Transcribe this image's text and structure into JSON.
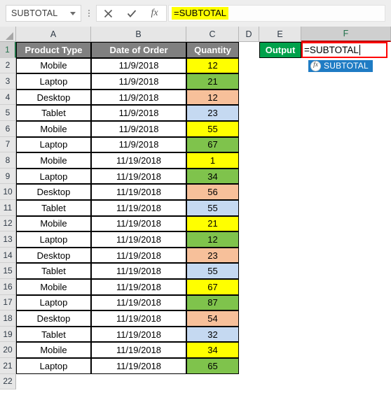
{
  "formula_bar": {
    "name_box_value": "SUBTOTAL",
    "name_box_icon": "chevron-down-icon",
    "cancel_icon": "cancel-x-icon",
    "confirm_icon": "confirm-check-icon",
    "insert_function_icon": "fx-icon",
    "insert_function_label": "fx",
    "formula_value": "=SUBTOTAL"
  },
  "columns": [
    {
      "label": "A",
      "selected": false
    },
    {
      "label": "B",
      "selected": false
    },
    {
      "label": "C",
      "selected": false
    },
    {
      "label": "D",
      "selected": false
    },
    {
      "label": "E",
      "selected": false
    },
    {
      "label": "F",
      "selected": true
    }
  ],
  "row_numbers": [
    "1",
    "2",
    "3",
    "4",
    "5",
    "6",
    "7",
    "8",
    "9",
    "10",
    "11",
    "12",
    "13",
    "14",
    "15",
    "16",
    "17",
    "18",
    "19",
    "20",
    "21",
    "22"
  ],
  "table": {
    "headers": [
      "Product Type",
      "Date of Order",
      "Quantity"
    ],
    "header_bg": "#808080",
    "header_color": "#ffffff",
    "rows": [
      {
        "product": "Mobile",
        "date": "11/9/2018",
        "qty": "12",
        "qty_color": "#ffff00"
      },
      {
        "product": "Laptop",
        "date": "11/9/2018",
        "qty": "21",
        "qty_color": "#7fc34c"
      },
      {
        "product": "Desktop",
        "date": "11/9/2018",
        "qty": "12",
        "qty_color": "#f7c09a"
      },
      {
        "product": "Tablet",
        "date": "11/9/2018",
        "qty": "23",
        "qty_color": "#c5d9f1"
      },
      {
        "product": "Mobile",
        "date": "11/9/2018",
        "qty": "55",
        "qty_color": "#ffff00"
      },
      {
        "product": "Laptop",
        "date": "11/9/2018",
        "qty": "67",
        "qty_color": "#7fc34c"
      },
      {
        "product": "Mobile",
        "date": "11/19/2018",
        "qty": "1",
        "qty_color": "#ffff00"
      },
      {
        "product": "Laptop",
        "date": "11/19/2018",
        "qty": "34",
        "qty_color": "#7fc34c"
      },
      {
        "product": "Desktop",
        "date": "11/19/2018",
        "qty": "56",
        "qty_color": "#f7c09a"
      },
      {
        "product": "Tablet",
        "date": "11/19/2018",
        "qty": "55",
        "qty_color": "#c5d9f1"
      },
      {
        "product": "Mobile",
        "date": "11/19/2018",
        "qty": "21",
        "qty_color": "#ffff00"
      },
      {
        "product": "Laptop",
        "date": "11/19/2018",
        "qty": "12",
        "qty_color": "#7fc34c"
      },
      {
        "product": "Desktop",
        "date": "11/19/2018",
        "qty": "23",
        "qty_color": "#f7c09a"
      },
      {
        "product": "Tablet",
        "date": "11/19/2018",
        "qty": "55",
        "qty_color": "#c5d9f1"
      },
      {
        "product": "Mobile",
        "date": "11/19/2018",
        "qty": "67",
        "qty_color": "#ffff00"
      },
      {
        "product": "Laptop",
        "date": "11/19/2018",
        "qty": "87",
        "qty_color": "#7fc34c"
      },
      {
        "product": "Desktop",
        "date": "11/19/2018",
        "qty": "54",
        "qty_color": "#f7c09a"
      },
      {
        "product": "Tablet",
        "date": "11/19/2018",
        "qty": "32",
        "qty_color": "#c5d9f1"
      },
      {
        "product": "Mobile",
        "date": "11/19/2018",
        "qty": "34",
        "qty_color": "#ffff00"
      },
      {
        "product": "Laptop",
        "date": "11/19/2018",
        "qty": "65",
        "qty_color": "#7fc34c"
      }
    ]
  },
  "output": {
    "label": "Output",
    "label_bg": "#00a14b",
    "label_color": "#ffffff",
    "cell_value": "=SUBTOTAL",
    "cell_border_color": "#ff0000"
  },
  "autocomplete": {
    "icon": "fx-icon",
    "icon_label": "fx",
    "item_label": "SUBTOTAL",
    "bg": "#1f7cc4",
    "color": "#ffffff"
  }
}
